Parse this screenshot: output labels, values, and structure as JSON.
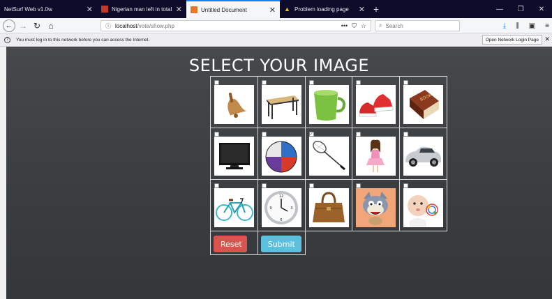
{
  "tabs": [
    {
      "label": "NetSurf Web v1.0w",
      "active": false
    },
    {
      "label": "Nigerian man left in total shoc",
      "active": false
    },
    {
      "label": "Untitled Document",
      "active": true
    },
    {
      "label": "Problem loading page",
      "active": false
    }
  ],
  "nav": {
    "url_host": "localhost",
    "url_path": "/vote/show.php",
    "search_placeholder": "Search"
  },
  "notification": {
    "message": "You must log in to this network before you can access the Internet.",
    "button": "Open Network Login Page"
  },
  "page": {
    "title": "SELECT YOUR IMAGE",
    "images": [
      {
        "name": "bell",
        "checked": false
      },
      {
        "name": "table",
        "checked": false
      },
      {
        "name": "cup",
        "checked": false
      },
      {
        "name": "sneakers",
        "checked": false
      },
      {
        "name": "book",
        "checked": false
      },
      {
        "name": "tv",
        "checked": false
      },
      {
        "name": "ball",
        "checked": false
      },
      {
        "name": "racket",
        "checked": true
      },
      {
        "name": "doll",
        "checked": false
      },
      {
        "name": "car",
        "checked": false
      },
      {
        "name": "bicycle",
        "checked": false
      },
      {
        "name": "clock",
        "checked": false
      },
      {
        "name": "handbag",
        "checked": false
      },
      {
        "name": "cartoon-cat",
        "checked": false
      },
      {
        "name": "baby",
        "checked": false
      }
    ],
    "reset_label": "Reset",
    "submit_label": "Submit"
  },
  "colors": {
    "reset": "#d9534f",
    "submit": "#5bc0de",
    "tab_bar": "#0c0c2a",
    "page_bg": "#3e4144"
  }
}
